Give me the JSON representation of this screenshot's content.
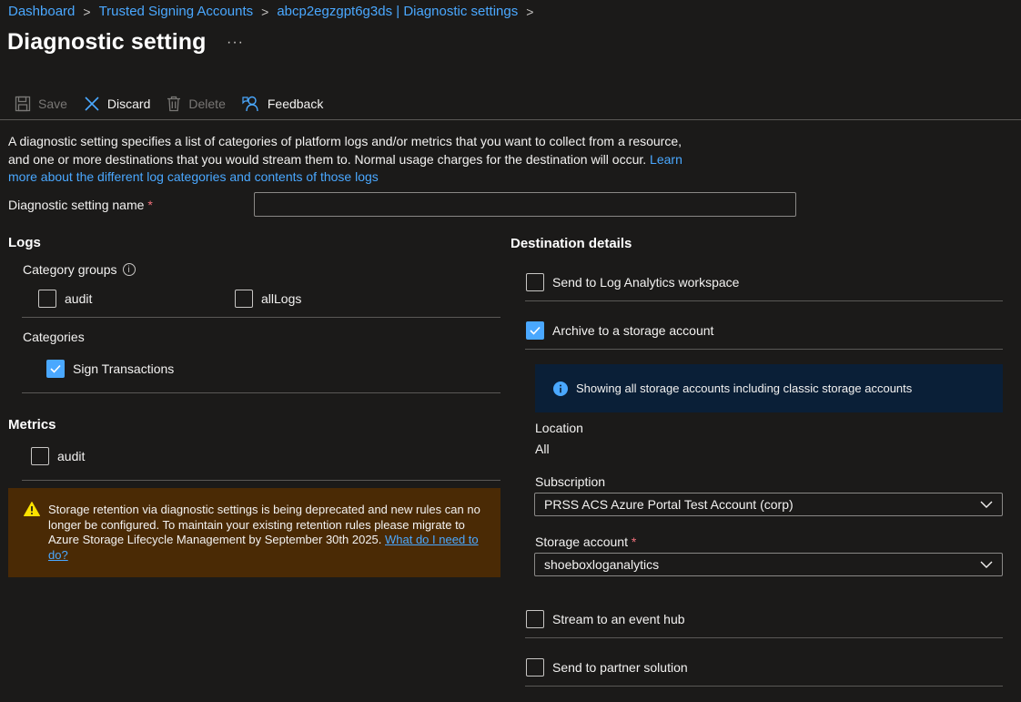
{
  "breadcrumb": [
    {
      "label": "Dashboard"
    },
    {
      "label": "Trusted Signing Accounts"
    },
    {
      "label": "abcp2egzgpt6g3ds | Diagnostic settings"
    }
  ],
  "page": {
    "title": "Diagnostic setting",
    "more": "···"
  },
  "toolbar": {
    "save": "Save",
    "discard": "Discard",
    "delete": "Delete",
    "feedback": "Feedback"
  },
  "description": {
    "text": "A diagnostic setting specifies a list of categories of platform logs and/or metrics that you want to collect from a resource, and one or more destinations that you would stream them to. Normal usage charges for the destination will occur. ",
    "link": "Learn more about the different log categories and contents of those logs"
  },
  "name_field": {
    "label": "Diagnostic setting name",
    "required_mark": "*",
    "value": "",
    "placeholder": ""
  },
  "logs": {
    "title": "Logs",
    "category_groups_label": "Category groups",
    "info_icon": "i",
    "groups": [
      {
        "label": "audit",
        "checked": false
      },
      {
        "label": "allLogs",
        "checked": false
      }
    ],
    "categories_label": "Categories",
    "categories": [
      {
        "label": "Sign Transactions",
        "checked": true
      }
    ]
  },
  "metrics": {
    "title": "Metrics",
    "items": [
      {
        "label": "audit",
        "checked": false
      }
    ]
  },
  "warning": {
    "text": "Storage retention via diagnostic settings is being deprecated and new rules can no longer be configured. To maintain your existing retention rules please migrate to Azure Storage Lifecycle Management by September 30th 2025. ",
    "link": "What do I need to do?"
  },
  "destination": {
    "title": "Destination details",
    "log_analytics": {
      "label": "Send to Log Analytics workspace",
      "checked": false
    },
    "storage": {
      "label": "Archive to a storage account",
      "checked": true
    },
    "info": "Showing all storage accounts including classic storage accounts",
    "location_label": "Location",
    "location_value": "All",
    "subscription_label": "Subscription",
    "subscription_value": "PRSS ACS Azure Portal Test Account (corp)",
    "storage_account_label": "Storage account",
    "storage_account_value": "shoeboxloganalytics",
    "event_hub": {
      "label": "Stream to an event hub",
      "checked": false
    },
    "partner": {
      "label": "Send to partner solution",
      "checked": false
    }
  },
  "colors": {
    "background": "#1b1a19",
    "link": "#4aa8ff",
    "checkbox_checked": "#4aa8ff",
    "warning_bg": "#4a2a05",
    "info_bg": "#0a1f37"
  }
}
